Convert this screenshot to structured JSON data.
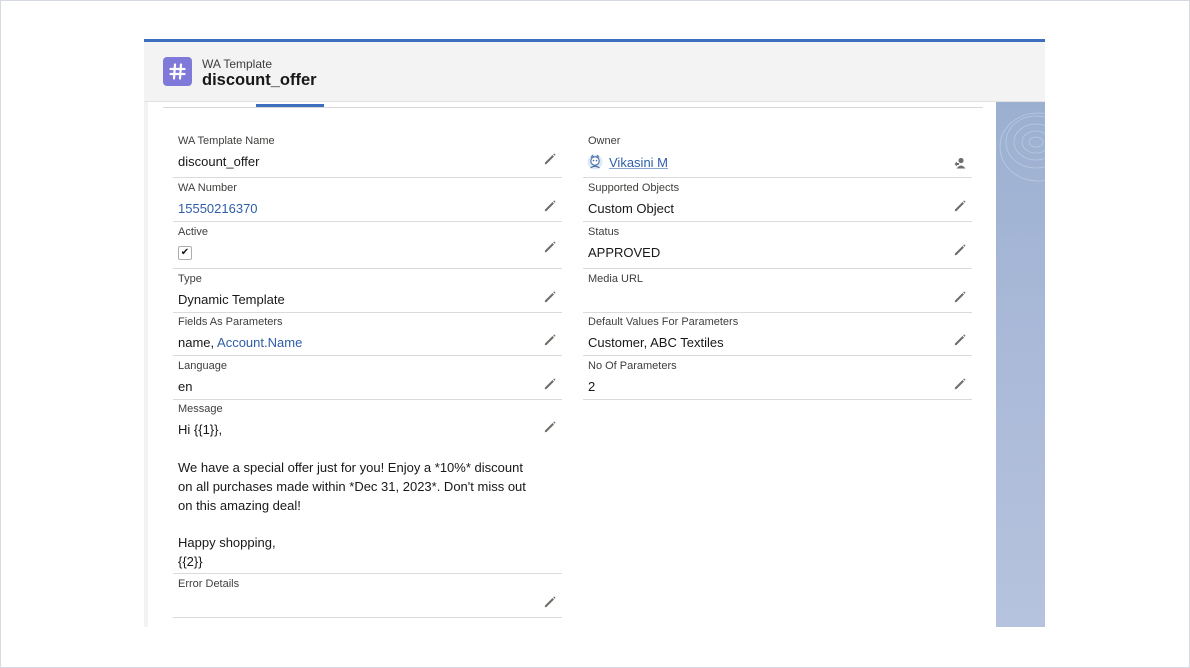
{
  "header": {
    "object_type": "WA Template",
    "record_title": "discount_offer"
  },
  "left_fields": [
    {
      "label": "WA Template Name",
      "value": "discount_offer"
    },
    {
      "label": "WA Number",
      "value": "15550216370"
    },
    {
      "label": "Active",
      "value": "✔"
    },
    {
      "label": "Type",
      "value": "Dynamic Template"
    },
    {
      "label": "Fields As Parameters",
      "value_prefix": "name, ",
      "value_link": "Account.Name"
    },
    {
      "label": "Language",
      "value": "en"
    },
    {
      "label": "Message",
      "lines": [
        "Hi {{1}},",
        "We have a special offer just for you! Enjoy a *10%* discount",
        "on all purchases made within *Dec 31, 2023*. Don't miss out",
        "on this amazing deal!",
        "Happy shopping,",
        "{{2}}"
      ]
    },
    {
      "label": "Error Details",
      "value": ""
    }
  ],
  "right_fields": [
    {
      "label": "Owner",
      "value": "Vikasini M"
    },
    {
      "label": "Supported Objects",
      "value": "Custom Object"
    },
    {
      "label": "Status",
      "value": "APPROVED"
    },
    {
      "label": "Media URL",
      "value": ""
    },
    {
      "label": "Default Values For Parameters",
      "value": "Customer, ABC Textiles"
    },
    {
      "label": "No Of Parameters",
      "value": "2"
    }
  ],
  "colors": {
    "accent": "#3e6ebd",
    "object_icon": "#7f7ad9",
    "link": "#2e5ea8"
  },
  "icons": {
    "object": "hashtag-icon",
    "edit": "pencil-icon",
    "owner_avatar": "user-avatar-icon",
    "change_owner": "change-owner-icon"
  }
}
